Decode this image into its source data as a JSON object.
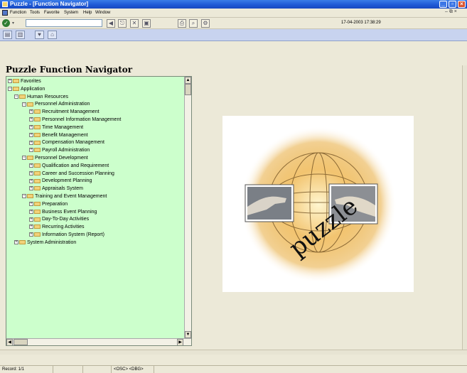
{
  "window": {
    "title": "Puzzle - [Function Navigator]"
  },
  "menu": {
    "items": [
      {
        "label": "Function"
      },
      {
        "label": "Tools"
      },
      {
        "label": "Favorite"
      },
      {
        "label": "System"
      },
      {
        "label": "Help"
      },
      {
        "label": "Window"
      }
    ],
    "mdi_controls": "– ⧉ ×"
  },
  "toolbar": {
    "command_value": "",
    "datetime": "17-04-2003 17:38:29"
  },
  "page": {
    "title": "Puzzle Function Navigator"
  },
  "tree": [
    {
      "label": "Favorites",
      "level": 0,
      "expanded": false
    },
    {
      "label": "Application",
      "level": 0,
      "expanded": true
    },
    {
      "label": "Human Resources",
      "level": 1,
      "expanded": true
    },
    {
      "label": "Personnel Administration",
      "level": 2,
      "expanded": true
    },
    {
      "label": "Recruitment Management",
      "level": 3,
      "expanded": false
    },
    {
      "label": "Personnel Information Management",
      "level": 3,
      "expanded": false
    },
    {
      "label": "Time Management",
      "level": 3,
      "expanded": false
    },
    {
      "label": "Benefit Management",
      "level": 3,
      "expanded": false
    },
    {
      "label": "Compensation Management",
      "level": 3,
      "expanded": false
    },
    {
      "label": "Payroll Administration",
      "level": 3,
      "expanded": false
    },
    {
      "label": "Personnel Development",
      "level": 2,
      "expanded": true
    },
    {
      "label": "Qualification and Requirement",
      "level": 3,
      "expanded": false
    },
    {
      "label": "Career and Succession Planning",
      "level": 3,
      "expanded": false
    },
    {
      "label": "Development Planning",
      "level": 3,
      "expanded": false
    },
    {
      "label": "Appraisals System",
      "level": 3,
      "expanded": false
    },
    {
      "label": "Training and Event Management",
      "level": 2,
      "expanded": true
    },
    {
      "label": "Preparation",
      "level": 3,
      "expanded": false
    },
    {
      "label": "Business Event Planning",
      "level": 3,
      "expanded": false
    },
    {
      "label": "Day-To-Day Activities",
      "level": 3,
      "expanded": false
    },
    {
      "label": "Recurring Activities",
      "level": 3,
      "expanded": false
    },
    {
      "label": "Information System (Report)",
      "level": 3,
      "expanded": false
    },
    {
      "label": "System Administration",
      "level": 1,
      "expanded": false
    }
  ],
  "logo": {
    "text": "puzzle"
  },
  "status": {
    "record": "Record: 1/1",
    "mode": "<OSC> <DBG>"
  },
  "colors": {
    "tree_bg": "#ccffcc",
    "title_bar": "#1f5ad6",
    "toolbar2": "#c8d3ef"
  }
}
